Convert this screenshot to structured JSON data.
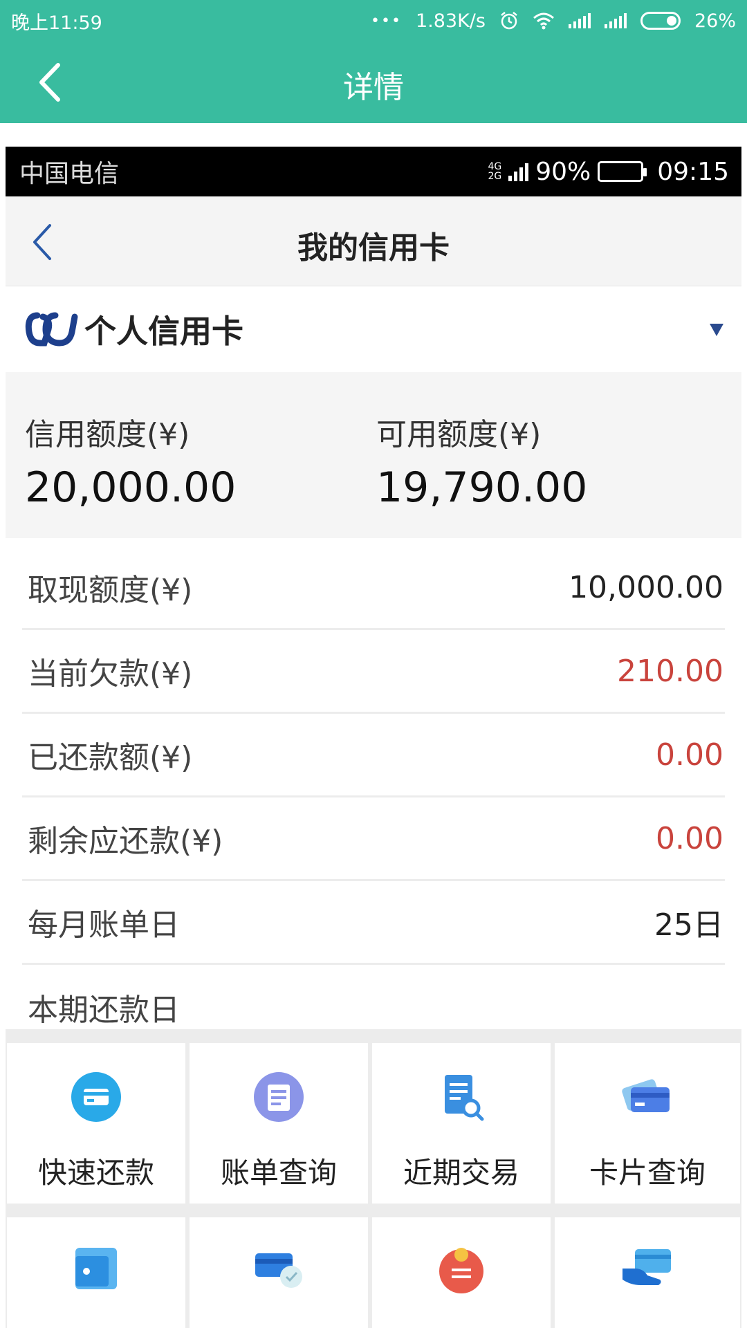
{
  "outer_status": {
    "time": "晚上11:59",
    "dots": "•••",
    "speed": "1.83K/s",
    "battery": "26%"
  },
  "outer_header": {
    "title": "详情"
  },
  "inner_status": {
    "carrier": "中国电信",
    "net_top": "4G",
    "net_bottom": "2G",
    "battery": "90%",
    "time": "09:15"
  },
  "inner_nav": {
    "title": "我的信用卡"
  },
  "card_select": {
    "label": "个人信用卡"
  },
  "limits": {
    "credit_label": "信用额度(¥)",
    "credit_value": "20,000.00",
    "available_label": "可用额度(¥)",
    "available_value": "19,790.00"
  },
  "details": [
    {
      "label": "取现额度(¥)",
      "value": "10,000.00",
      "highlight": false
    },
    {
      "label": "当前欠款(¥)",
      "value": "210.00",
      "highlight": true
    },
    {
      "label": "已还款额(¥)",
      "value": "0.00",
      "highlight": true
    },
    {
      "label": "剩余应还款(¥)",
      "value": "0.00",
      "highlight": true
    },
    {
      "label": "每月账单日",
      "value": "25日",
      "highlight": false
    },
    {
      "label": "本期还款日",
      "value": "",
      "highlight": false
    }
  ],
  "actions": [
    {
      "label": "快速还款",
      "icon": "card-repay-icon"
    },
    {
      "label": "账单查询",
      "icon": "bill-icon"
    },
    {
      "label": "近期交易",
      "icon": "document-search-icon"
    },
    {
      "label": "卡片查询",
      "icon": "cards-icon"
    }
  ],
  "actions_row2": [
    {
      "icon": "wallet-icon"
    },
    {
      "icon": "card-shield-icon"
    },
    {
      "icon": "badge-icon"
    },
    {
      "icon": "card-hand-icon"
    }
  ],
  "colors": {
    "header_green": "#39bc9f",
    "amount_red": "#c9433c",
    "bank_blue": "#1d3f8c"
  }
}
